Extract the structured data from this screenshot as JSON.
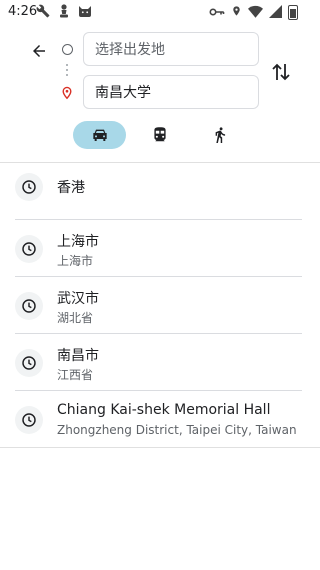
{
  "status_bar": {
    "time": "4:26",
    "left_icons": [
      "wrench-icon",
      "chess-pawn-icon",
      "android-cat-icon"
    ],
    "right_icons": [
      "key-icon",
      "location-icon",
      "wifi-icon",
      "signal-icon",
      "battery-icon"
    ]
  },
  "search": {
    "origin_placeholder": "选择出发地",
    "destination_value": "南昌大学"
  },
  "modes": [
    {
      "name": "car-icon",
      "selected": true
    },
    {
      "name": "transit-icon",
      "selected": false
    },
    {
      "name": "walk-icon",
      "selected": false
    }
  ],
  "colors": {
    "accent_selected_mode": "#a8d8e8",
    "pin_red": "#d93025"
  },
  "history": [
    {
      "title": "香港",
      "subtitle": ""
    },
    {
      "title": "上海市",
      "subtitle": "上海市"
    },
    {
      "title": "武汉市",
      "subtitle": "湖北省"
    },
    {
      "title": "南昌市",
      "subtitle": "江西省"
    },
    {
      "title": "Chiang Kai-shek Memorial Hall",
      "subtitle": "Zhongzheng District, Taipei City, Taiwan"
    }
  ]
}
